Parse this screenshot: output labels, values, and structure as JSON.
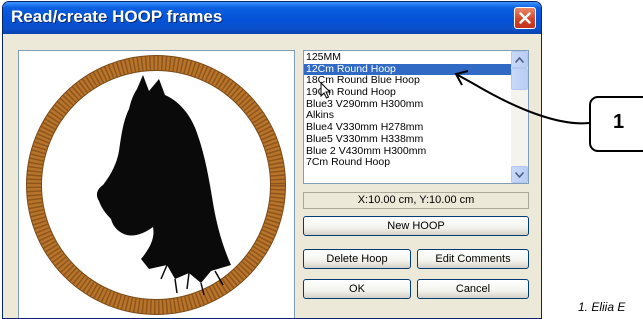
{
  "dialog": {
    "title": "Read/create HOOP frames",
    "list_items": [
      "125MM",
      "12Cm Round Hoop",
      "18Cm Round Blue Hoop",
      "19Cm Round Hoop",
      "Blue3  V290mm H300mm",
      "Alkins",
      "Blue4 V330mm H278mm",
      "Blue5 V330mm H338mm",
      "Blue 2  V430mm H300mm",
      "7Cm Round Hoop"
    ],
    "selected_index": 1,
    "coordinates": "X:10.00 cm, Y:10.00 cm",
    "buttons": {
      "new_hoop": "New HOOP",
      "delete_hoop": "Delete Hoop",
      "edit_comments": "Edit Comments",
      "ok": "OK",
      "cancel": "Cancel"
    }
  },
  "callout": {
    "number": "1"
  },
  "footnote": "1. Eliia E",
  "colors": {
    "title_bar": "#0553d8",
    "selection": "#316ac5",
    "hoop_ring": "#b8742a",
    "close_button": "#d2452a"
  },
  "icons": [
    "close-icon",
    "scroll-up-icon",
    "scroll-down-icon",
    "mouse-cursor-icon",
    "horse-head-image",
    "callout-arrow"
  ]
}
